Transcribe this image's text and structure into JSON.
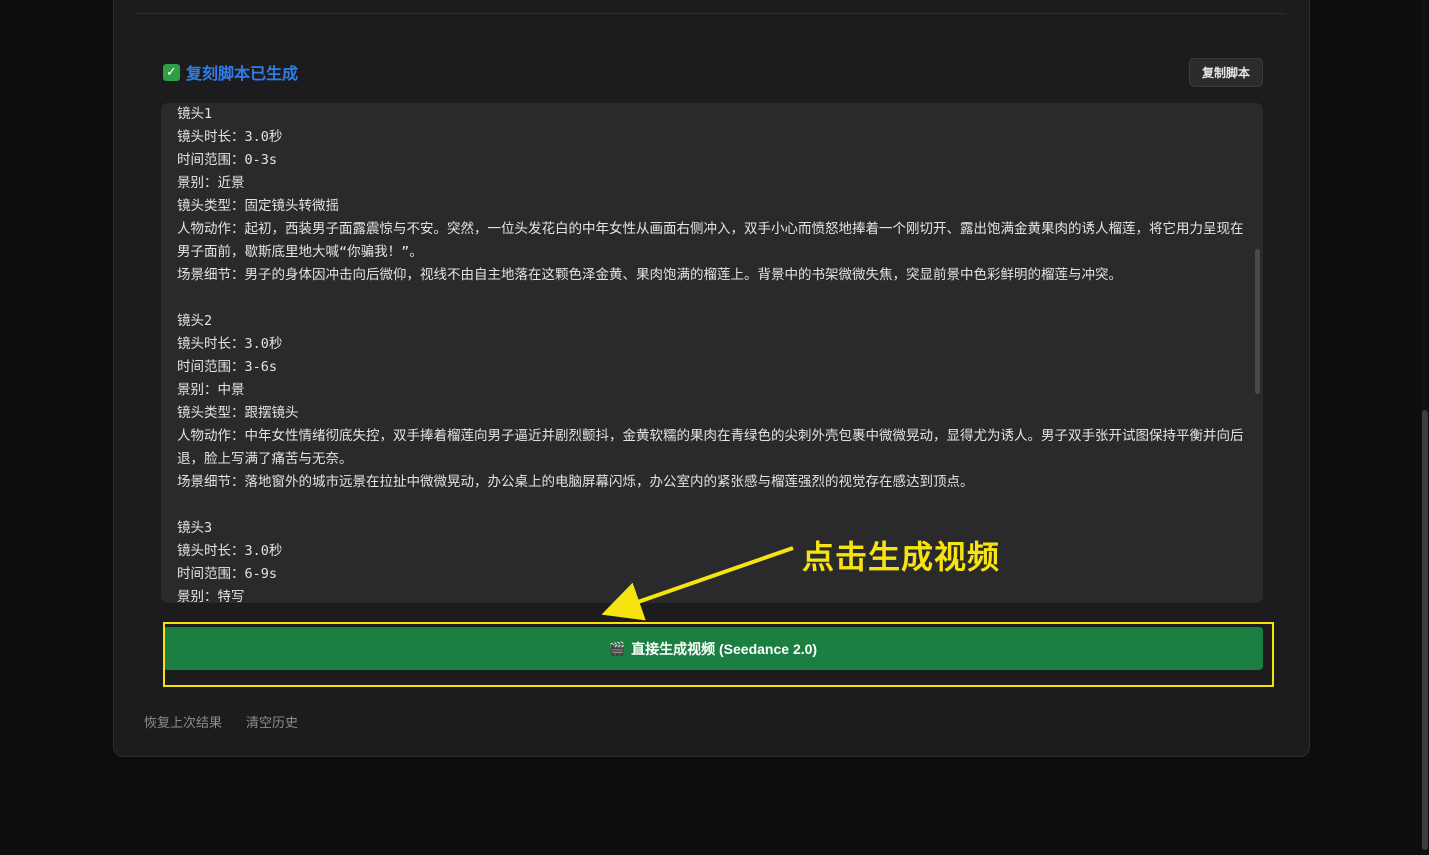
{
  "status": {
    "icon": "check-icon",
    "icon_glyph": "✓",
    "title": "复刻脚本已生成"
  },
  "toolbar": {
    "copy_label": "复制脚本"
  },
  "script": {
    "lines": [
      "镜头1",
      "镜头时长：3.0秒",
      "时间范围：0-3s",
      "景别：近景",
      "镜头类型：固定镜头转微摇",
      "人物动作：起初，西装男子面露震惊与不安。突然，一位头发花白的中年女性从画面右侧冲入，双手小心而愤怒地捧着一个刚切开、露出饱满金黄果肉的诱人榴莲，将它用力呈现在男子面前，歇斯底里地大喊“你骗我！”。",
      "场景细节：男子的身体因冲击向后微仰，视线不由自主地落在这颗色泽金黄、果肉饱满的榴莲上。背景中的书架微微失焦，突显前景中色彩鲜明的榴莲与冲突。",
      "",
      "镜头2",
      "镜头时长：3.0秒",
      "时间范围：3-6s",
      "景别：中景",
      "镜头类型：跟摆镜头",
      "人物动作：中年女性情绪彻底失控，双手捧着榴莲向男子逼近并剧烈颤抖，金黄软糯的果肉在青绿色的尖刺外壳包裹中微微晃动，显得尤为诱人。男子双手张开试图保持平衡并向后退，脸上写满了痛苦与无奈。",
      "场景细节：落地窗外的城市远景在拉扯中微微晃动，办公桌上的电脑屏幕闪烁，办公室内的紧张感与榴莲强烈的视觉存在感达到顶点。",
      "",
      "镜头3",
      "镜头时长：3.0秒",
      "时间范围：6-9s",
      "景别：特写"
    ]
  },
  "generate": {
    "icon": "clapper-board-icon",
    "icon_glyph": "🎬",
    "label": "直接生成视频 (Seedance 2.0)"
  },
  "links": {
    "restore": "恢复上次结果",
    "clear": "清空历史"
  },
  "annotation": {
    "text": "点击生成视频",
    "color": "#f7e30f"
  },
  "colors": {
    "accent_blue": "#2f7de9",
    "button_green": "#1a7f40",
    "check_green": "#2ea043",
    "highlight_yellow": "#f5e20a"
  }
}
